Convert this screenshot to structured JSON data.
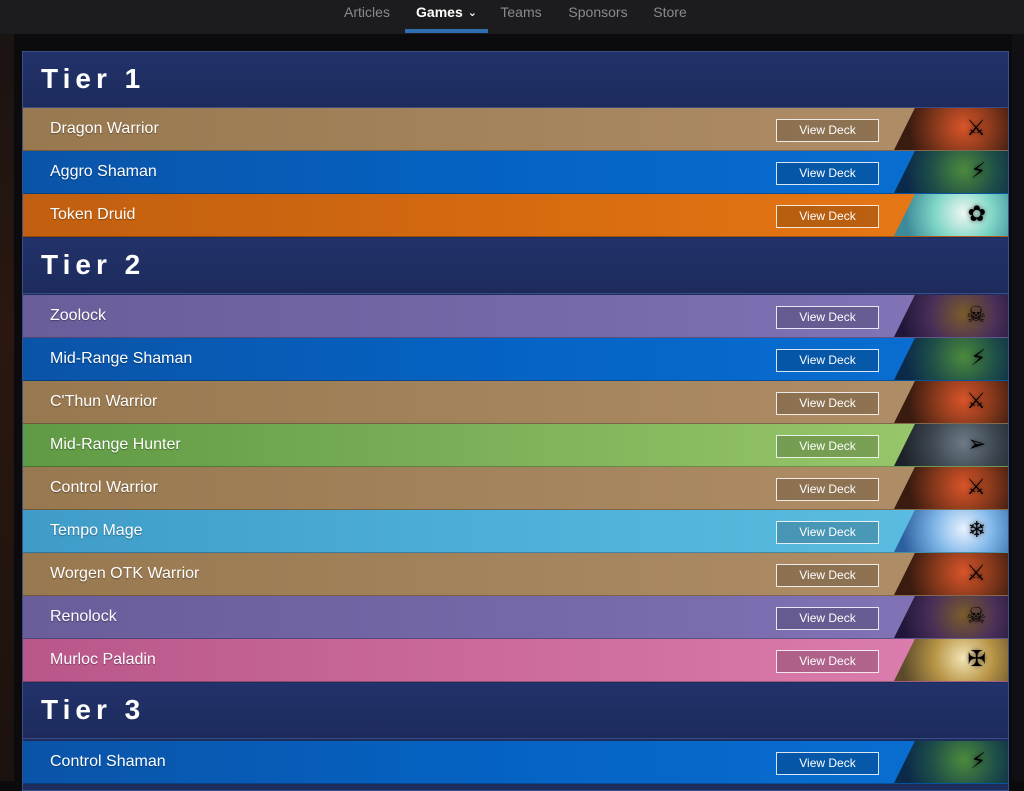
{
  "nav": {
    "items": [
      "Articles",
      "Games",
      "Teams",
      "Sponsors",
      "Store"
    ],
    "active": "Games",
    "colors": {
      "active_underline": "#2f6fb0"
    }
  },
  "tiers": [
    {
      "title": "Tier 1",
      "decks": [
        {
          "name": "Dragon Warrior",
          "button": "View Deck",
          "hero_icon": "warrior-portrait-icon"
        },
        {
          "name": "Aggro Shaman",
          "button": "View Deck",
          "hero_icon": "shaman-portrait-icon"
        },
        {
          "name": "Token Druid",
          "button": "View Deck",
          "hero_icon": "druid-portrait-icon"
        }
      ]
    },
    {
      "title": "Tier 2",
      "decks": [
        {
          "name": "Zoolock",
          "button": "View Deck",
          "hero_icon": "warlock-portrait-icon"
        },
        {
          "name": "Mid-Range Shaman",
          "button": "View Deck",
          "hero_icon": "shaman-portrait-icon"
        },
        {
          "name": "C'Thun Warrior",
          "button": "View Deck",
          "hero_icon": "warrior-portrait-icon"
        },
        {
          "name": "Mid-Range Hunter",
          "button": "View Deck",
          "hero_icon": "hunter-portrait-icon"
        },
        {
          "name": "Control Warrior",
          "button": "View Deck",
          "hero_icon": "warrior-portrait-icon"
        },
        {
          "name": "Tempo Mage",
          "button": "View Deck",
          "hero_icon": "mage-portrait-icon"
        },
        {
          "name": "Worgen OTK Warrior",
          "button": "View Deck",
          "hero_icon": "warrior-portrait-icon"
        },
        {
          "name": "Renolock",
          "button": "View Deck",
          "hero_icon": "warlock-portrait-icon"
        },
        {
          "name": "Murloc Paladin",
          "button": "View Deck",
          "hero_icon": "paladin-portrait-icon"
        }
      ]
    },
    {
      "title": "Tier 3",
      "decks": [
        {
          "name": "Control Shaman",
          "button": "View Deck",
          "hero_icon": "shaman-portrait-icon"
        }
      ]
    }
  ],
  "colors": {
    "panel_bg": "#1d2d5b",
    "warrior": "#a4845c",
    "shaman": "#0563c4",
    "druid": "#d56a10",
    "warlock": "#7468a8",
    "hunter": "#7fb25a",
    "mage": "#4eb0d8",
    "paladin": "#cc6b9c"
  }
}
